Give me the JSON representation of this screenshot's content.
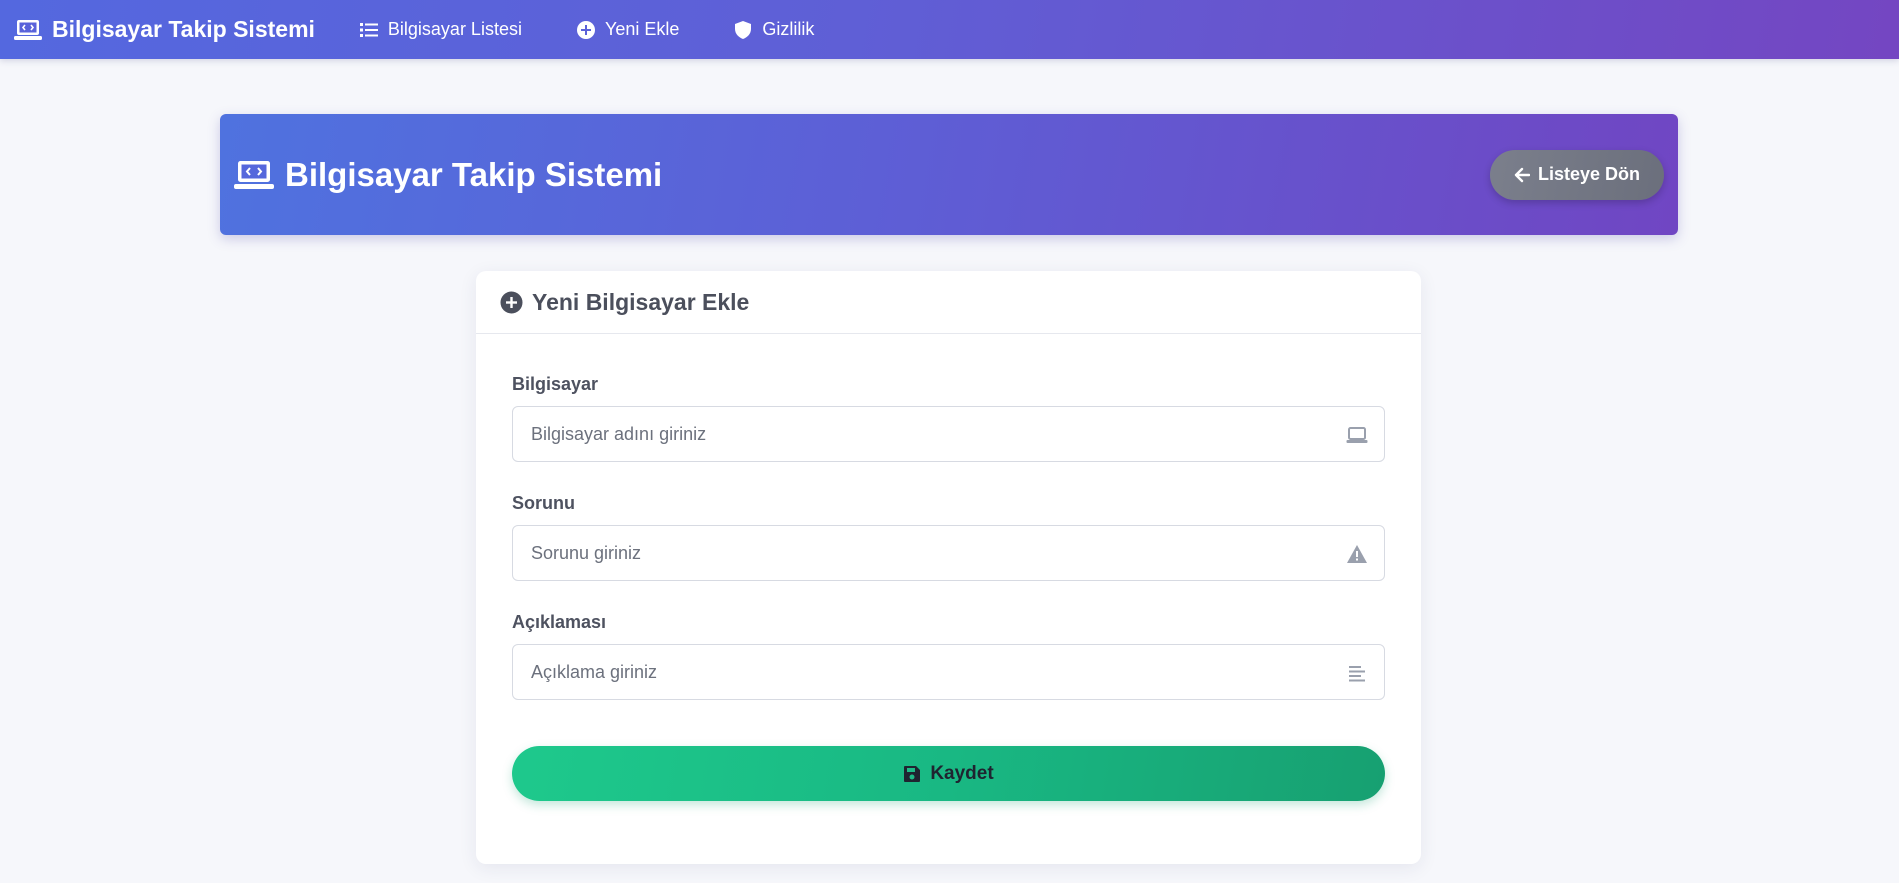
{
  "navbar": {
    "brand": "Bilgisayar Takip Sistemi",
    "brand_icon": "laptop-code-icon",
    "items": [
      {
        "label": "Bilgisayar Listesi",
        "icon": "list-icon"
      },
      {
        "label": "Yeni Ekle",
        "icon": "plus-circle-icon"
      },
      {
        "label": "Gizlilik",
        "icon": "shield-icon"
      }
    ]
  },
  "header": {
    "title": "Bilgisayar Takip Sistemi",
    "title_icon": "laptop-code-icon",
    "back_button": "Listeye Dön",
    "back_icon": "arrow-left-icon"
  },
  "form": {
    "title": "Yeni Bilgisayar Ekle",
    "title_icon": "plus-circle-icon",
    "fields": [
      {
        "label": "Bilgisayar",
        "placeholder": "Bilgisayar adını giriniz",
        "value": "",
        "icon": "laptop-icon"
      },
      {
        "label": "Sorunu",
        "placeholder": "Sorunu giriniz",
        "value": "",
        "icon": "warning-icon"
      },
      {
        "label": "Açıklaması",
        "placeholder": "Açıklama giriniz",
        "value": "",
        "icon": "align-left-icon"
      }
    ],
    "submit_label": "Kaydet",
    "submit_icon": "save-icon"
  },
  "colors": {
    "nav_gradient_start": "#5468df",
    "nav_gradient_end": "#7446c2",
    "save_button": "#1ec98c",
    "back_button": "#747884"
  }
}
